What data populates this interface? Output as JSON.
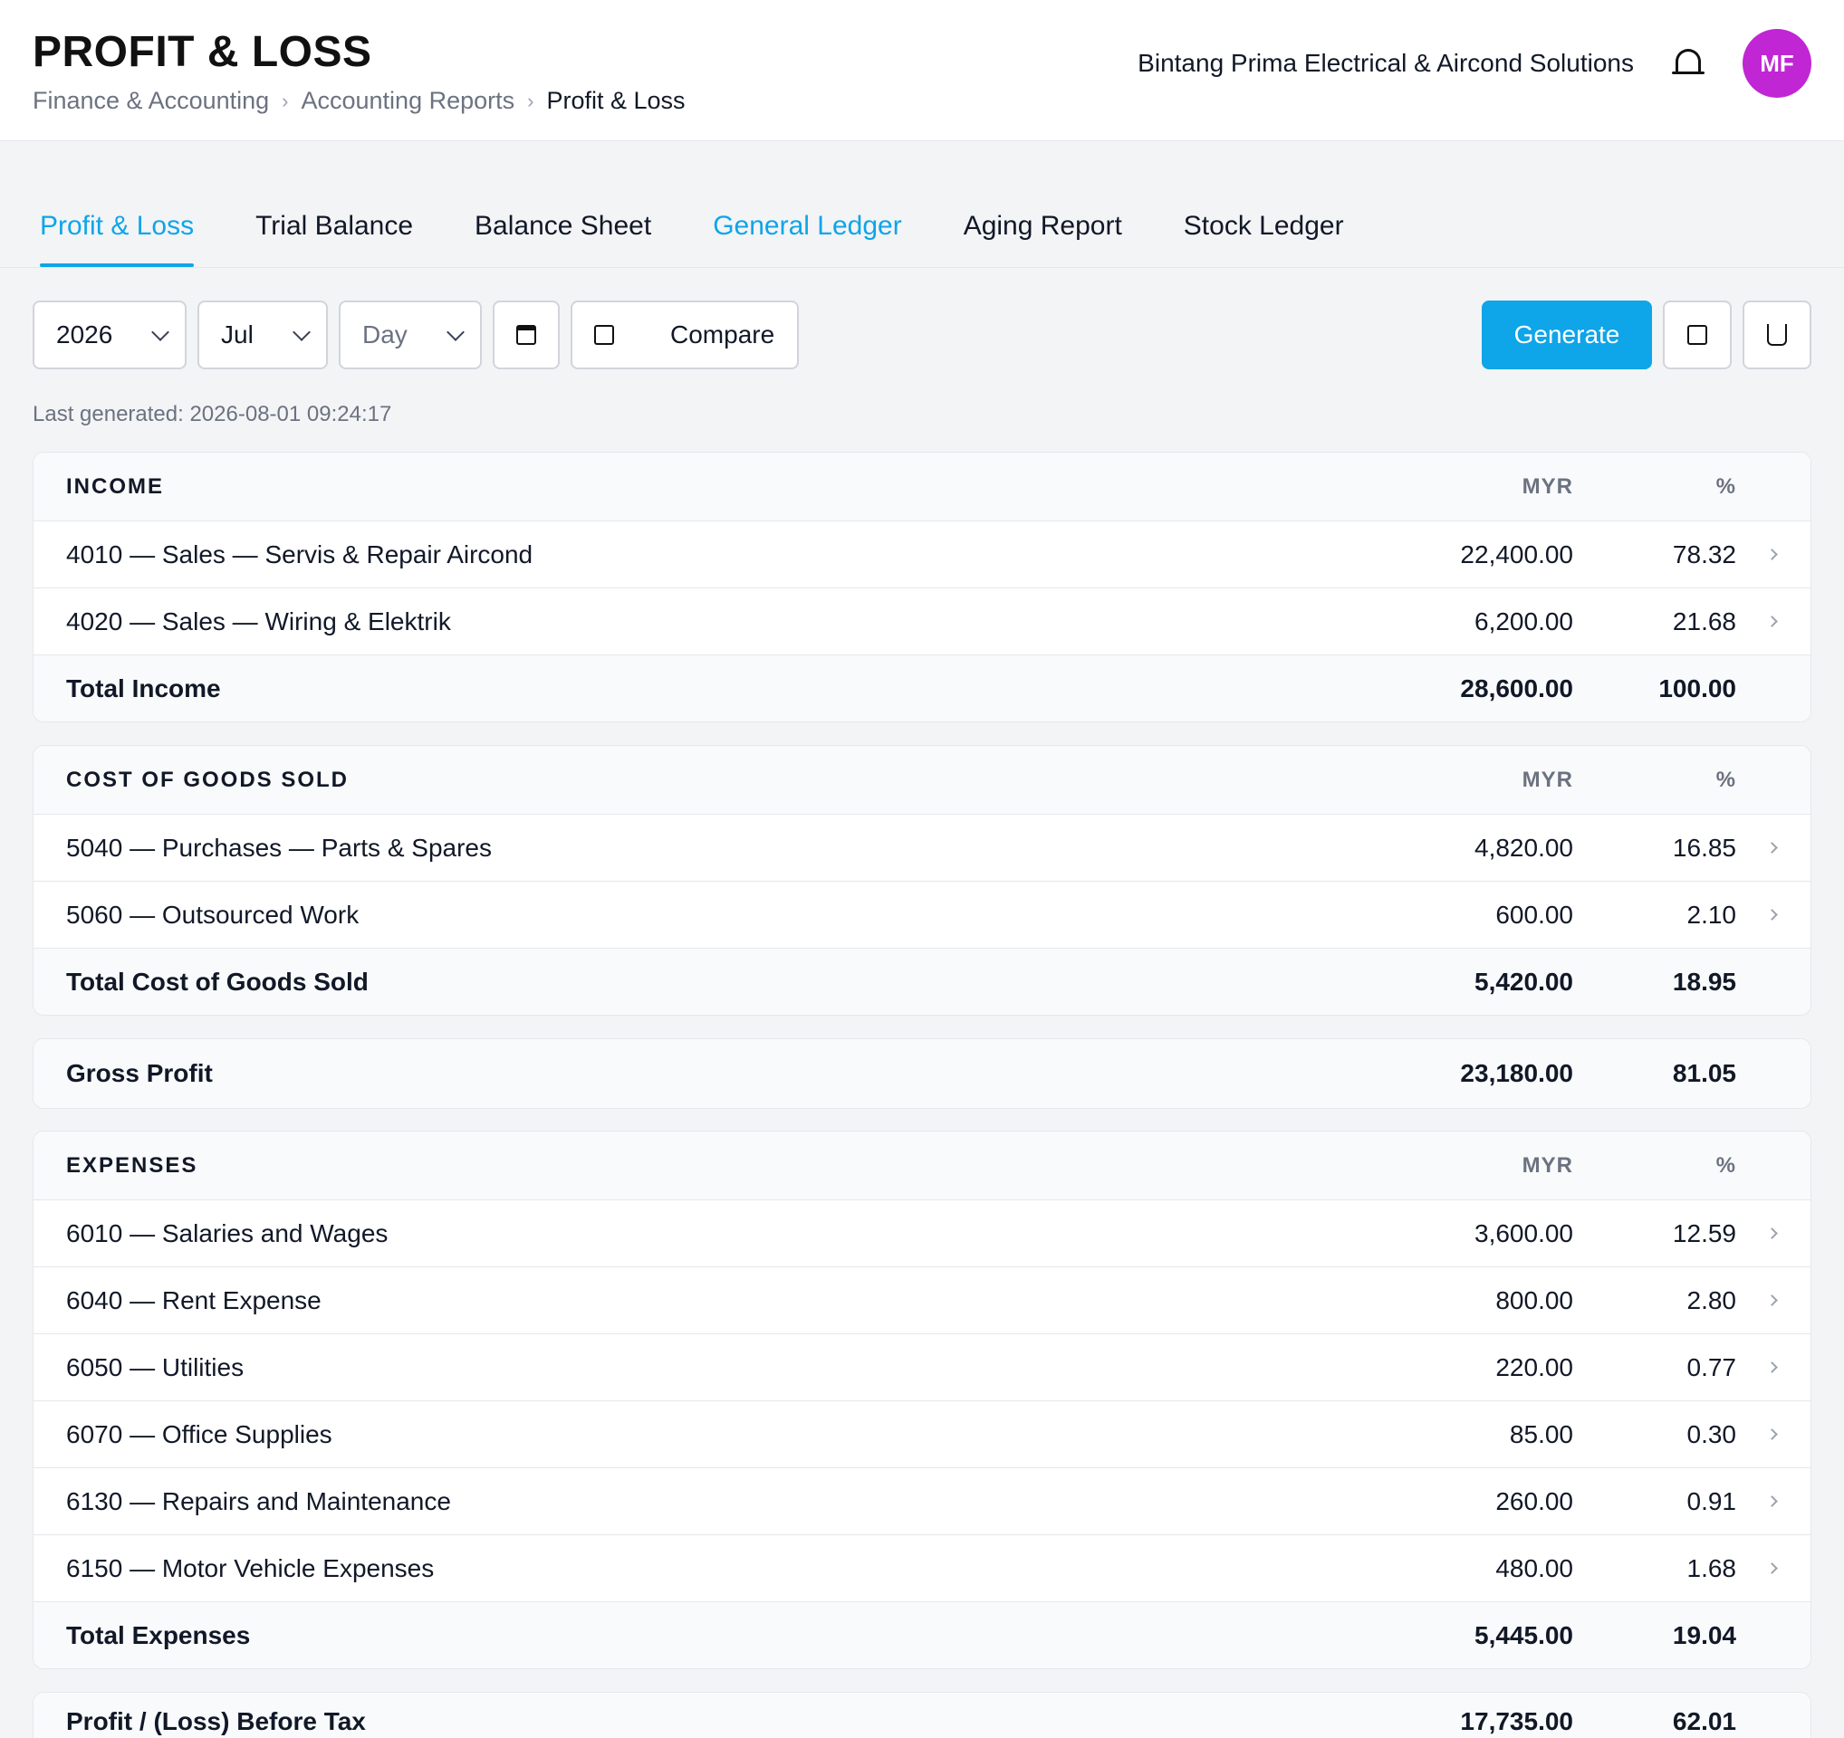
{
  "header": {
    "title": "PROFIT & LOSS",
    "breadcrumb": [
      "Finance & Accounting",
      "Accounting Reports",
      "Profit & Loss"
    ],
    "company": "Bintang Prima Electrical & Aircond Solutions",
    "avatar_initials": "MF"
  },
  "tabs": [
    {
      "label": "Profit & Loss"
    },
    {
      "label": "Trial Balance"
    },
    {
      "label": "Balance Sheet"
    },
    {
      "label": "General Ledger"
    },
    {
      "label": "Aging Report"
    },
    {
      "label": "Stock Ledger"
    }
  ],
  "toolbar": {
    "year": "2026",
    "month": "Jul",
    "day_placeholder": "Day",
    "compare_label": "Compare",
    "generate_label": "Generate"
  },
  "last_generated": "Last generated: 2026-08-01 09:24:17",
  "columns": {
    "amount": "MYR",
    "percent": "%"
  },
  "income": {
    "heading": "INCOME",
    "rows": [
      {
        "label": "4010 — Sales — Servis & Repair Aircond",
        "amount": "22,400.00",
        "percent": "78.32"
      },
      {
        "label": "4020 — Sales — Wiring & Elektrik",
        "amount": "6,200.00",
        "percent": "21.68"
      }
    ],
    "total": {
      "label": "Total Income",
      "amount": "28,600.00",
      "percent": "100.00"
    }
  },
  "cogs": {
    "heading": "COST OF GOODS SOLD",
    "rows": [
      {
        "label": "5040 — Purchases — Parts & Spares",
        "amount": "4,820.00",
        "percent": "16.85"
      },
      {
        "label": "5060 — Outsourced Work",
        "amount": "600.00",
        "percent": "2.10"
      }
    ],
    "total": {
      "label": "Total Cost of Goods Sold",
      "amount": "5,420.00",
      "percent": "18.95"
    }
  },
  "gross_profit": {
    "label": "Gross Profit",
    "amount": "23,180.00",
    "percent": "81.05"
  },
  "expenses": {
    "heading": "EXPENSES",
    "rows": [
      {
        "label": "6010 — Salaries and Wages",
        "amount": "3,600.00",
        "percent": "12.59"
      },
      {
        "label": "6040 — Rent Expense",
        "amount": "800.00",
        "percent": "2.80"
      },
      {
        "label": "6050 — Utilities",
        "amount": "220.00",
        "percent": "0.77"
      },
      {
        "label": "6070 — Office Supplies",
        "amount": "85.00",
        "percent": "0.30"
      },
      {
        "label": "6130 — Repairs and Maintenance",
        "amount": "260.00",
        "percent": "0.91"
      },
      {
        "label": "6150 — Motor Vehicle Expenses",
        "amount": "480.00",
        "percent": "1.68"
      }
    ],
    "total": {
      "label": "Total Expenses",
      "amount": "5,445.00",
      "percent": "19.04"
    }
  },
  "profit_before_tax": {
    "label": "Profit / (Loss) Before Tax",
    "amount": "17,735.00",
    "percent": "62.01"
  }
}
